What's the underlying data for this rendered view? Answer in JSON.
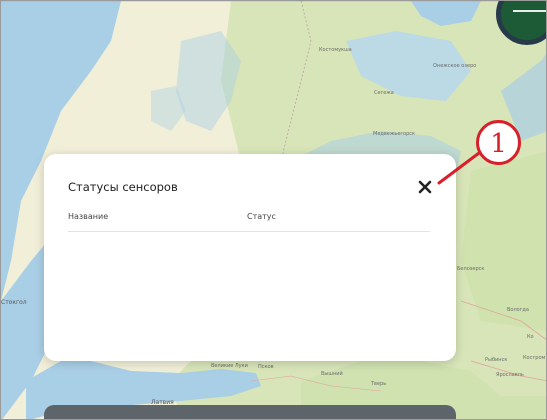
{
  "map": {
    "labels": {
      "latvia": "Латвия",
      "stockholm_partial": "Стокгол",
      "belozersk": "Белозерск",
      "vologda": "Вологда",
      "rybinsk": "Рыбинск",
      "kostroma_partial": "Костром",
      "yaroslavl": "Ярославль",
      "pskov": "Псков",
      "kotlas_partial": "Ко",
      "onega_lake": "Онежское озеро",
      "karelia": "Костомукша",
      "medvezhyegorsk": "Медвежьегорск",
      "segezha": "Сегежа",
      "tver": "Тверь",
      "vyshny": "Вышний",
      "velikiye": "Великие Луки"
    },
    "colors": {
      "water": "#a9cfe6",
      "land": "#f1efd8",
      "forest": "#c9e0a9"
    }
  },
  "modal": {
    "title": "Статусы сенсоров",
    "close_icon": "close-icon",
    "columns": {
      "name": "Название",
      "status": "Статус"
    },
    "rows": []
  },
  "annotation": {
    "number": "1",
    "color": "#d8202a"
  }
}
